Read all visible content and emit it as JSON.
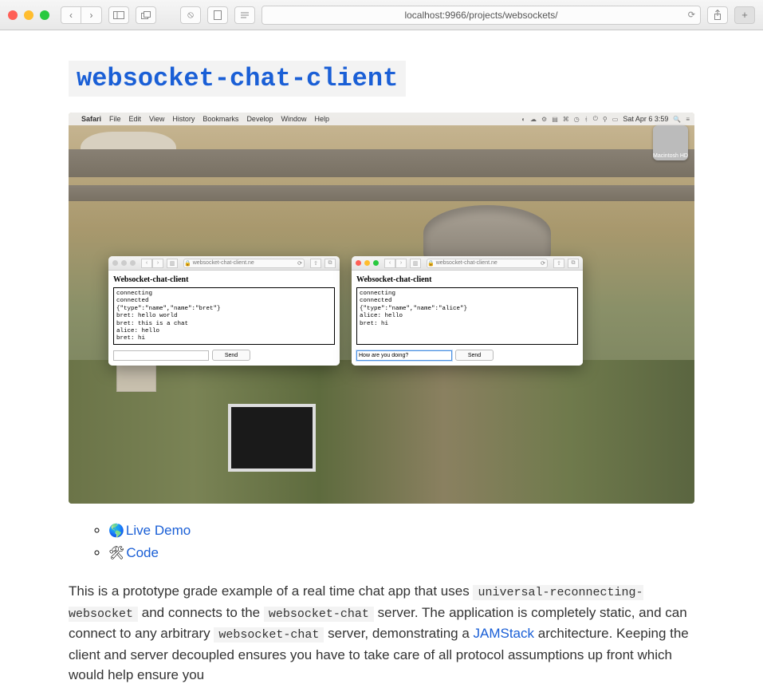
{
  "browser": {
    "url": "localhost:9966/projects/websockets/"
  },
  "page": {
    "title": "websocket-chat-client"
  },
  "screenshot": {
    "menubar": {
      "app": "Safari",
      "menus": [
        "File",
        "Edit",
        "View",
        "History",
        "Bookmarks",
        "Develop",
        "Window",
        "Help"
      ],
      "clock": "Sat Apr 6  3:59"
    },
    "disk_label": "Macintosh HD",
    "window_left": {
      "addr": "websocket-chat-client.ne",
      "title": "Websocket-chat-client",
      "chat": "connecting\nconnected\n{\"type\":\"name\",\"name\":\"bret\"}\nbret: hello world\nbret: this is a chat\nalice: hello\nbret: hi",
      "input_value": "",
      "send_label": "Send"
    },
    "window_right": {
      "addr": "websocket-chat-client.ne",
      "title": "Websocket-chat-client",
      "chat": "connecting\nconnected\n{\"type\":\"name\",\"name\":\"alice\"}\nalice: hello\nbret: hi",
      "input_value": "How are you doing?",
      "send_label": "Send"
    }
  },
  "links": {
    "demo": {
      "icon": "🌎",
      "label": "Live Demo"
    },
    "code": {
      "icon": "🛠",
      "label": "Code"
    }
  },
  "desc": {
    "t1": "This is a prototype grade example of a real time chat app that uses ",
    "code1": "universal-reconnecting-websocket",
    "t2": " and connects to the ",
    "code2": "websocket-chat",
    "t3": " server. The application is completely static, and can connect to any arbitrary ",
    "code3": "websocket-chat",
    "t4": " server, demonstrating a ",
    "link_label": "JAMStack",
    "t5": " architecture. Keeping the client and server decoupled ensures you have to take care of all protocol assumptions up front which would help ensure you"
  }
}
